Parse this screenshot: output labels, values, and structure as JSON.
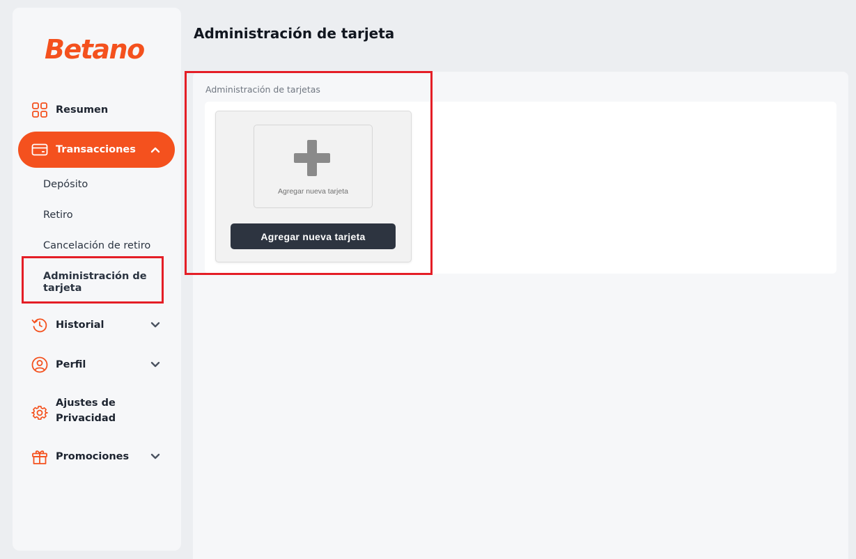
{
  "brand": {
    "logo_text": "Betano",
    "accent_color": "#f4511e"
  },
  "sidebar": {
    "items": [
      {
        "label": "Resumen",
        "icon": "grid-icon"
      },
      {
        "label": "Transacciones",
        "icon": "credit-card-icon",
        "active": true,
        "expanded": true,
        "children": [
          {
            "label": "Depósito"
          },
          {
            "label": "Retiro"
          },
          {
            "label": "Cancelación de retiro"
          },
          {
            "label": "Administración de tarjeta",
            "current": true
          }
        ]
      },
      {
        "label": "Historial",
        "icon": "history-icon"
      },
      {
        "label": "Perfil",
        "icon": "user-icon"
      },
      {
        "label": "Ajustes de Privacidad",
        "icon": "gear-icon"
      },
      {
        "label": "Promociones",
        "icon": "gift-icon"
      }
    ]
  },
  "main": {
    "title": "Administración de tarjeta",
    "section_label": "Administración de tarjetas",
    "add_tile_text": "Agregar nueva tarjeta",
    "add_button_label": "Agregar nueva tarjeta"
  },
  "annotation_color": "#e41e26"
}
